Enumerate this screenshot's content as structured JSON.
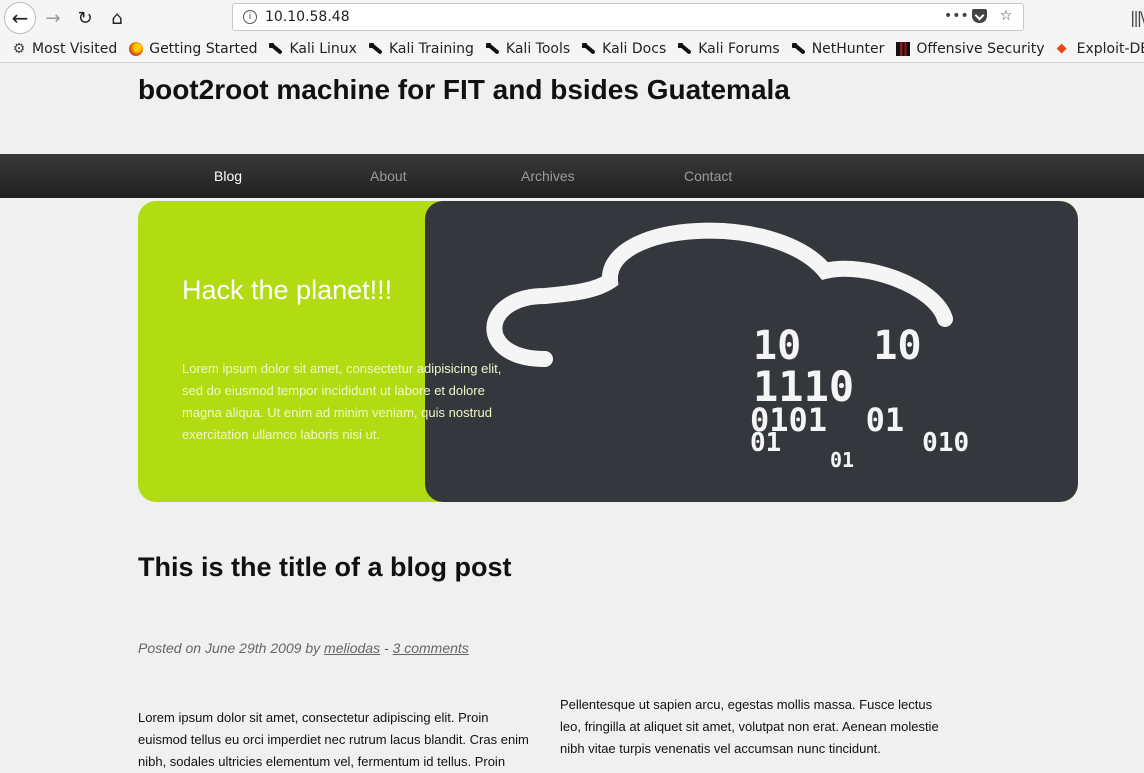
{
  "browser": {
    "url": "10.10.58.48",
    "bookmarks": [
      {
        "label": "Most Visited",
        "icon": "gear-icon"
      },
      {
        "label": "Getting Started",
        "icon": "firefox-icon"
      },
      {
        "label": "Kali Linux",
        "icon": "kali-dragon-icon"
      },
      {
        "label": "Kali Training",
        "icon": "kali-dragon-icon"
      },
      {
        "label": "Kali Tools",
        "icon": "kali-dragon-icon"
      },
      {
        "label": "Kali Docs",
        "icon": "kali-dragon-icon"
      },
      {
        "label": "Kali Forums",
        "icon": "kali-dragon-icon"
      },
      {
        "label": "NetHunter",
        "icon": "kali-dragon-icon"
      },
      {
        "label": "Offensive Security",
        "icon": "offsec-icon"
      },
      {
        "label": "Exploit-DB",
        "icon": "exploitdb-icon"
      }
    ]
  },
  "site": {
    "title": "boot2root machine for FIT and bsides Guatemala",
    "nav": [
      "Blog",
      "About",
      "Archives",
      "Contact"
    ],
    "active_nav": "Blog"
  },
  "hero": {
    "title": "Hack the planet!!!",
    "text": "Lorem ipsum dolor sit amet, consectetur adipisicing elit, sed do eiusmod tempor incididunt ut labore et dolore magna aliqua. Ut enim ad minim veniam, quis nostrud exercitation ullamco laboris nisi ut.",
    "binary_rows": [
      "10   10",
      "1110",
      "0101  01",
      "01         010",
      "01"
    ]
  },
  "post": {
    "title": "This is the title of a blog post",
    "meta_prefix": "Posted on June 29th 2009 by",
    "author": "meliodas",
    "separator": "-",
    "comments": "3 comments",
    "col_left": "Lorem ipsum dolor sit amet, consectetur adipiscing elit. Proin euismod tellus eu orci imperdiet nec rutrum lacus blandit. Cras enim nibh, sodales ultricies elementum vel, fermentum id tellus. Proin",
    "col_right": "Pellentesque ut sapien arcu, egestas mollis massa. Fusce lectus leo, fringilla at aliquet sit amet, volutpat non erat. Aenean molestie nibh vitae turpis venenatis vel accumsan nunc tincidunt."
  },
  "colors": {
    "hero_green": "#b2dc12",
    "hero_dark": "#34373c",
    "nav_bar": "#2a2a2a"
  }
}
